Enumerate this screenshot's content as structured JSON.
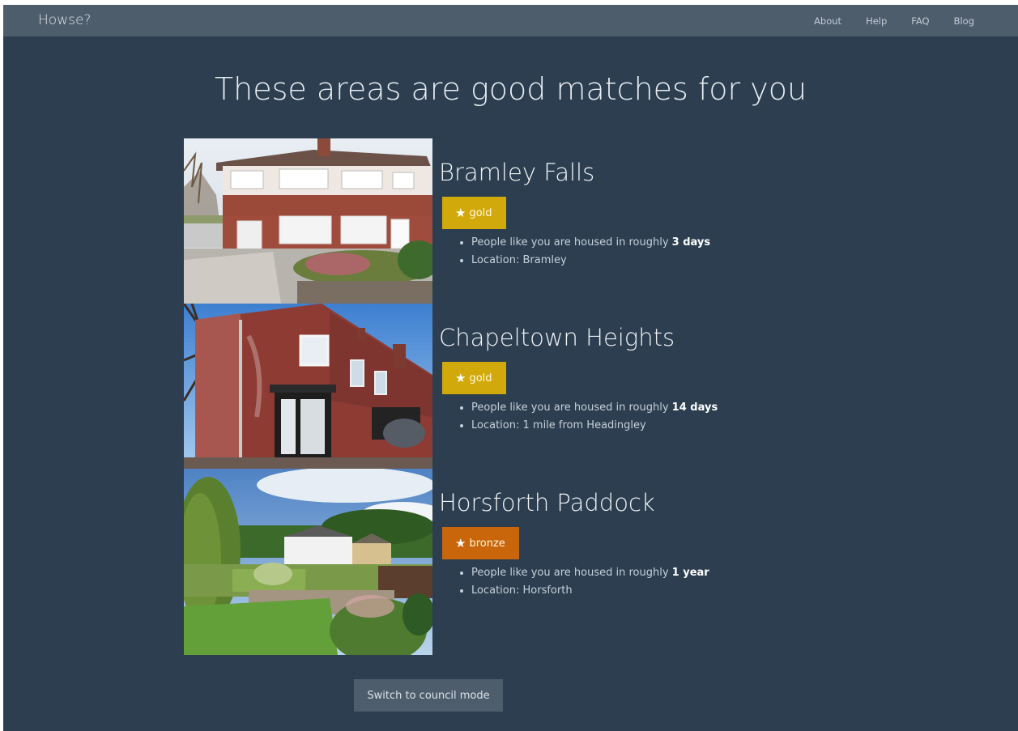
{
  "navbar": {
    "brand": "Howse?",
    "links": [
      "About",
      "Help",
      "FAQ",
      "Blog"
    ]
  },
  "page_title": "These areas are good matches for you",
  "areas": [
    {
      "name": "Bramley Falls",
      "rating": "gold",
      "housed_prefix": "People like you are housed in roughly ",
      "housed_time": "3 days",
      "location": "Location: Bramley"
    },
    {
      "name": "Chapeltown Heights",
      "rating": "gold",
      "housed_prefix": "People like you are housed in roughly ",
      "housed_time": "14 days",
      "location": "Location: 1 mile from Headingley"
    },
    {
      "name": "Horsforth Paddock",
      "rating": "bronze",
      "housed_prefix": "People like you are housed in roughly ",
      "housed_time": "1 year",
      "location": "Location: Horsforth"
    }
  ],
  "council_button": "Switch to council mode",
  "colors": {
    "background": "#2c3e50",
    "navbar": "#4e5d6c",
    "gold": "#d2a90a",
    "bronze": "#c9650b"
  },
  "icons": {
    "rating": "star-icon"
  }
}
